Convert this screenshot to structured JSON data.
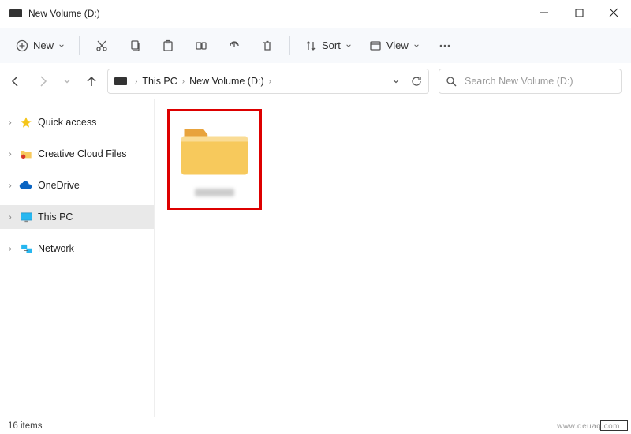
{
  "window": {
    "title": "New Volume (D:)"
  },
  "toolbar": {
    "new_label": "New",
    "sort_label": "Sort",
    "view_label": "View"
  },
  "breadcrumb": {
    "root": "This PC",
    "current": "New Volume (D:)"
  },
  "search": {
    "placeholder": "Search New Volume (D:)"
  },
  "navpane": {
    "quick_access": "Quick access",
    "creative_cloud": "Creative Cloud Files",
    "onedrive": "OneDrive",
    "this_pc": "This PC",
    "network": "Network"
  },
  "content": {
    "folder_name": ""
  },
  "statusbar": {
    "item_count": "16 items"
  },
  "watermark": "www.deuaq.com"
}
